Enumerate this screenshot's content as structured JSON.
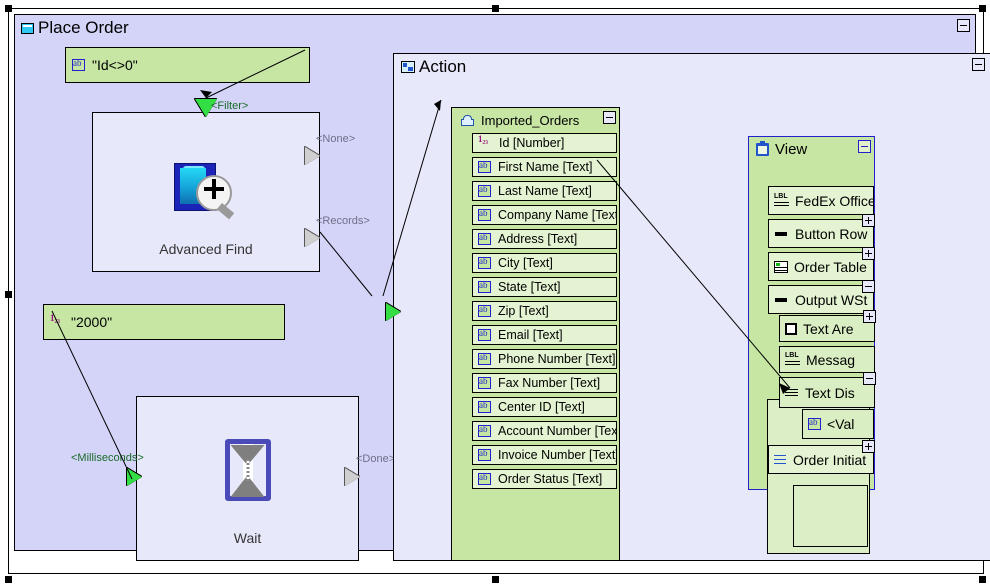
{
  "canvas": {
    "background": "#ffffff",
    "selection_handles": 8
  },
  "colors": {
    "container_fill": "#d3d4f7",
    "action_fill": "#e8e8fb",
    "expression_fill": "#c7e6a4",
    "field_fill": "#e4f3d2",
    "port_green": "#33dd44",
    "port_grey": "#cfcfcf",
    "view_border": "#2222cc",
    "label_green": "#1a6b2a",
    "label_grey": "#6f6f8a"
  },
  "place_order": {
    "title": "Place Order",
    "icon": "window-icon",
    "collapse_icon": "minimize-icon"
  },
  "expressions": [
    {
      "name": "filter-expression",
      "icon": "string-type-icon",
      "text": "\"Id<>0\""
    },
    {
      "name": "milliseconds-expression",
      "icon": "number-type-icon",
      "text": "\"2000\""
    }
  ],
  "nodes": [
    {
      "name": "advanced-find-node",
      "label": "Advanced Find",
      "icon": "advanced-find-icon",
      "input_ports": [
        {
          "label": "<Filter>",
          "color": "green",
          "direction": "down"
        }
      ],
      "output_ports": [
        {
          "label": "<None>",
          "color": "grey"
        },
        {
          "label": "<Records>",
          "color": "grey"
        }
      ]
    },
    {
      "name": "wait-node",
      "label": "Wait",
      "icon": "hourglass-icon",
      "input_ports": [
        {
          "label": "<Milliseconds>",
          "color": "green",
          "direction": "right"
        }
      ],
      "output_ports": [
        {
          "label": "<Done>",
          "color": "grey"
        }
      ]
    }
  ],
  "action": {
    "title": "Action",
    "icon": "action-icon",
    "collapse_icon": "minimize-icon",
    "input_port": {
      "label": "",
      "color": "green"
    }
  },
  "imported_orders": {
    "title": "Imported_Orders",
    "icon": "table-icon",
    "collapse_icon": "minimize-icon",
    "fields": [
      {
        "icon": "number-type-icon",
        "label": "Id [Number]"
      },
      {
        "icon": "string-type-icon",
        "label": "First Name [Text]"
      },
      {
        "icon": "string-type-icon",
        "label": "Last Name [Text]"
      },
      {
        "icon": "string-type-icon",
        "label": "Company Name [Text]"
      },
      {
        "icon": "string-type-icon",
        "label": "Address [Text]"
      },
      {
        "icon": "string-type-icon",
        "label": "City [Text]"
      },
      {
        "icon": "string-type-icon",
        "label": "State [Text]"
      },
      {
        "icon": "string-type-icon",
        "label": "Zip [Text]"
      },
      {
        "icon": "string-type-icon",
        "label": "Email [Text]"
      },
      {
        "icon": "string-type-icon",
        "label": "Phone Number [Text]"
      },
      {
        "icon": "string-type-icon",
        "label": "Fax Number [Text]"
      },
      {
        "icon": "string-type-icon",
        "label": "Center ID [Text]"
      },
      {
        "icon": "string-type-icon",
        "label": "Account Number [Text]"
      },
      {
        "icon": "string-type-icon",
        "label": "Invoice Number [Text]"
      },
      {
        "icon": "string-type-icon",
        "label": "Order Status [Text]"
      }
    ]
  },
  "view": {
    "title": "View",
    "icon": "view-icon",
    "collapse_icon": "minimize-icon",
    "items": [
      {
        "icon": "label-icon",
        "label": "FedEx Office",
        "expander": "none"
      },
      {
        "icon": "button-row-icon",
        "label": "Button Row",
        "expander": "plus"
      },
      {
        "icon": "grid-icon",
        "label": "Order Table",
        "expander": "plus"
      },
      {
        "icon": "button-row-icon",
        "label": "Output WSt",
        "expander": "minus"
      },
      {
        "icon": "checkbox-icon",
        "label": "Text Are",
        "expander": "plus",
        "nested": true
      },
      {
        "icon": "label-icon",
        "label": "Messag",
        "expander": "none",
        "nested": true
      },
      {
        "icon": "text-display-icon",
        "label": "Text Dis",
        "expander": "minus",
        "nested": true
      },
      {
        "icon": "string-type-icon",
        "label": "<Val",
        "expander": "none",
        "nested": true
      },
      {
        "icon": "list-icon",
        "label": "Order Initiat",
        "expander": "plus"
      }
    ]
  }
}
